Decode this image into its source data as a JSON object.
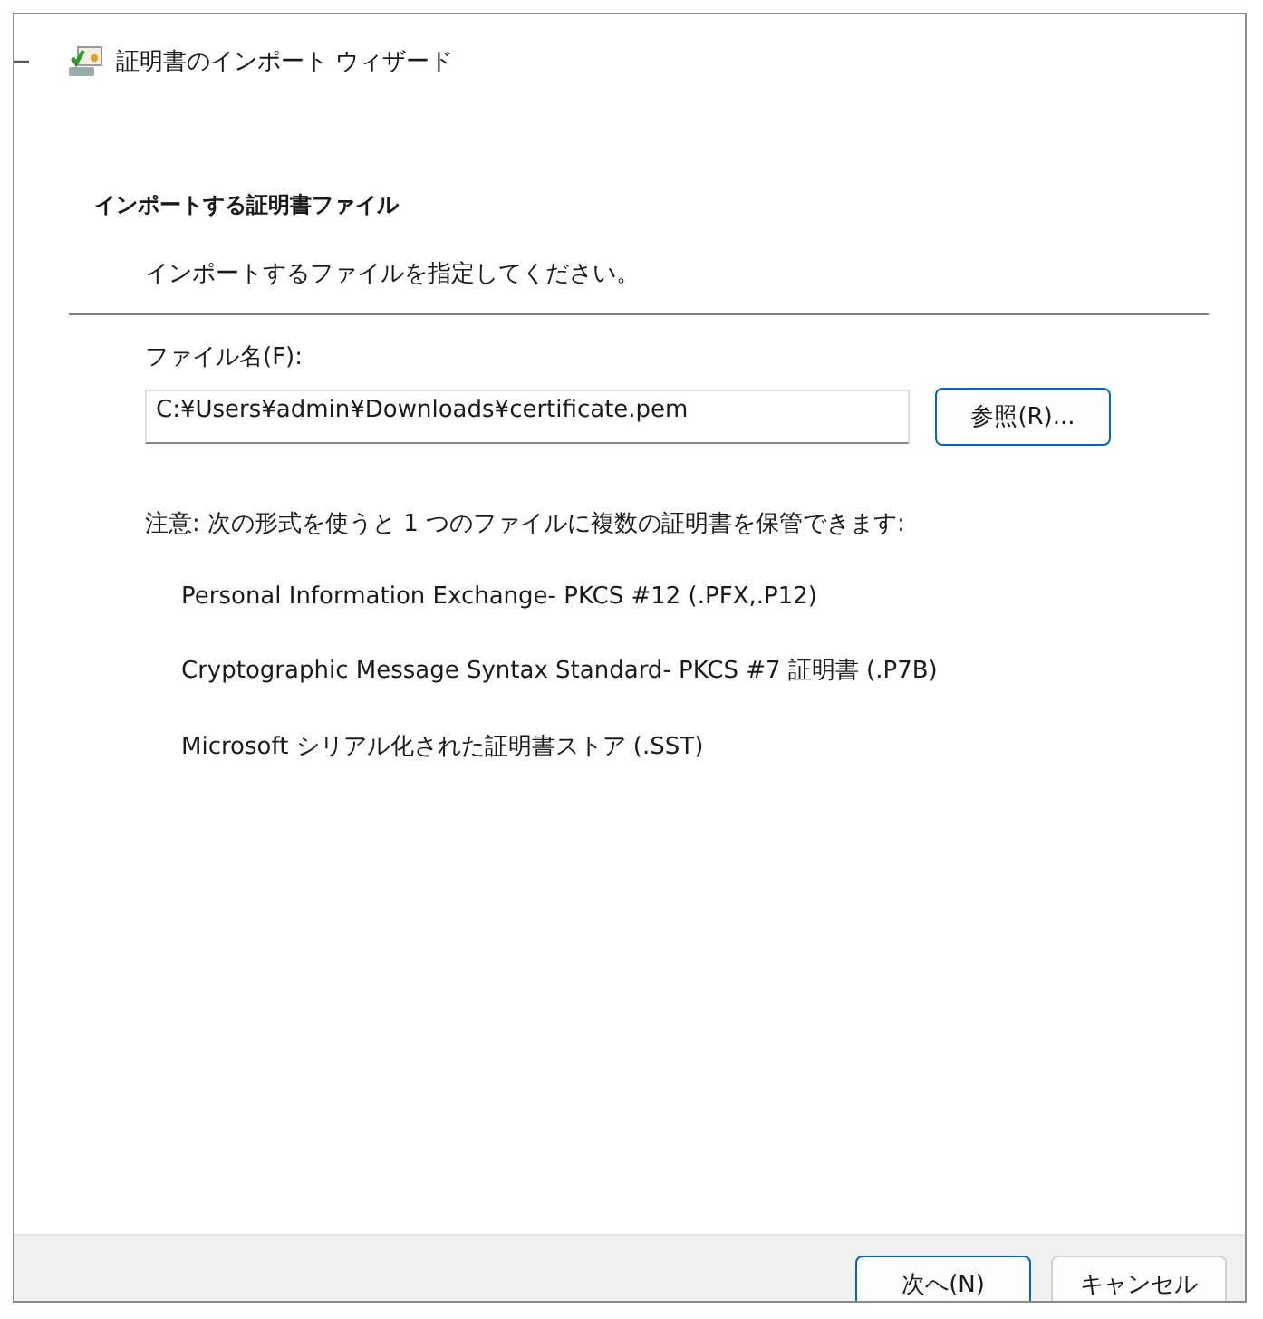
{
  "window": {
    "title": "証明書のインポート ウィザード"
  },
  "heading": "インポートする証明書ファイル",
  "subheading": "インポートするファイルを指定してください。",
  "file_field": {
    "label": "ファイル名(F):",
    "value": "C:¥Users¥admin¥Downloads¥certificate.pem"
  },
  "browse_button": "参照(R)...",
  "note": "注意: 次の形式を使うと 1 つのファイルに複数の証明書を保管できます:",
  "formats": [
    "Personal Information Exchange- PKCS #12 (.PFX,.P12)",
    "Cryptographic Message Syntax Standard- PKCS #7 証明書 (.P7B)",
    "Microsoft シリアル化された証明書ストア (.SST)"
  ],
  "buttons": [
    {
      "label": "次へ(N)",
      "kind": "default"
    },
    {
      "label": "キャンセル",
      "kind": "normal"
    }
  ]
}
